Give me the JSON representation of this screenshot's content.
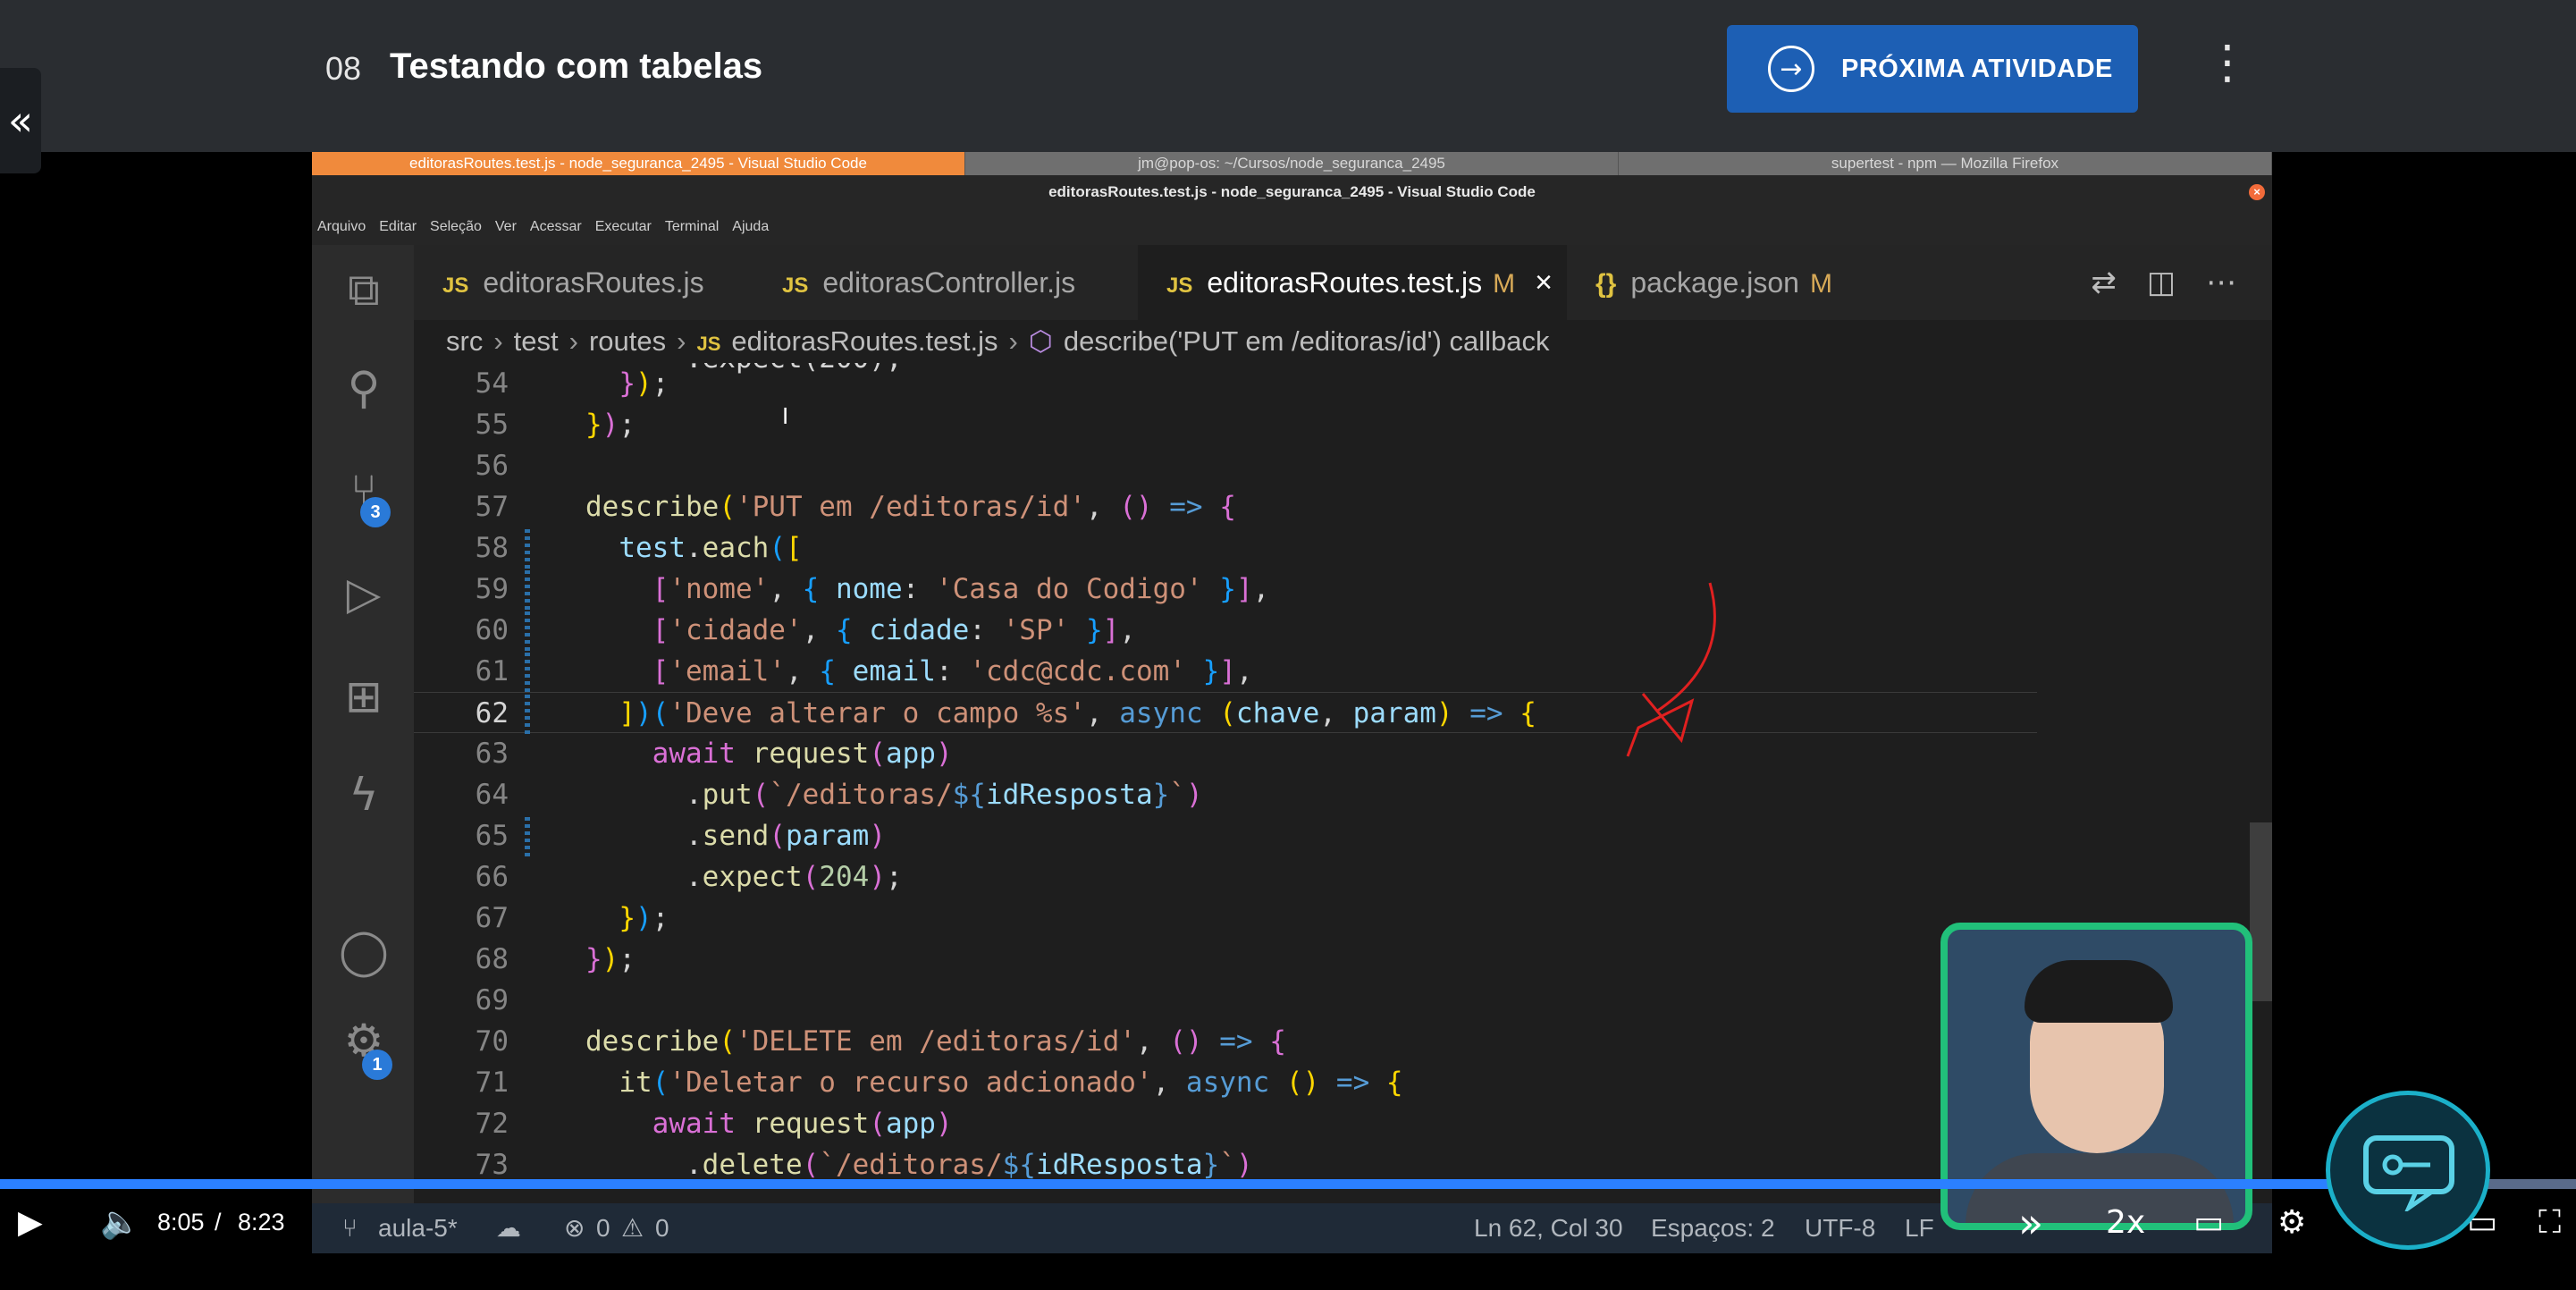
{
  "header": {
    "lesson_number": "08",
    "lesson_title": "Testando com tabelas",
    "next_button": "PRÓXIMA ATIVIDADE"
  },
  "os_tabs": [
    "editorasRoutes.test.js - node_seguranca_2495 - Visual Studio Code",
    "jm@pop-os: ~/Cursos/node_seguranca_2495",
    "supertest - npm — Mozilla Firefox"
  ],
  "vscode": {
    "window_title": "editorasRoutes.test.js - node_seguranca_2495 - Visual Studio Code",
    "menu": [
      "Arquivo",
      "Editar",
      "Seleção",
      "Ver",
      "Acessar",
      "Executar",
      "Terminal",
      "Ajuda"
    ],
    "tabs": [
      {
        "label": "editorasRoutes.js",
        "icon": "JS",
        "modified": ""
      },
      {
        "label": "editorasController.js",
        "icon": "JS",
        "modified": ""
      },
      {
        "label": "editorasRoutes.test.js",
        "icon": "JS",
        "modified": "M"
      },
      {
        "label": "package.json",
        "icon": "{}",
        "modified": "M"
      }
    ],
    "breadcrumb": [
      "src",
      "test",
      "routes",
      "editorasRoutes.test.js",
      "describe('PUT em /editoras/id') callback"
    ],
    "source_control_badge": "3",
    "settings_badge": "1",
    "line_numbers": [
      "54",
      "55",
      "56",
      "57",
      "58",
      "59",
      "60",
      "61",
      "62",
      "63",
      "64",
      "65",
      "66",
      "67",
      "68",
      "69",
      "70",
      "71",
      "72",
      "73"
    ],
    "statusbar": {
      "branch": "aula-5*",
      "errors": "0",
      "warnings": "0",
      "position": "Ln 62, Col 30",
      "spaces": "Espaços: 2",
      "encoding": "UTF-8",
      "eol": "LF"
    }
  },
  "player": {
    "current_time": "8:05",
    "separator": "/",
    "duration": "8:23",
    "progress": 0.964,
    "speed": "2x"
  },
  "colors": {
    "accent": "#1d5fb4",
    "progress": "#2b80ff",
    "webcam_border": "#21c07a"
  }
}
